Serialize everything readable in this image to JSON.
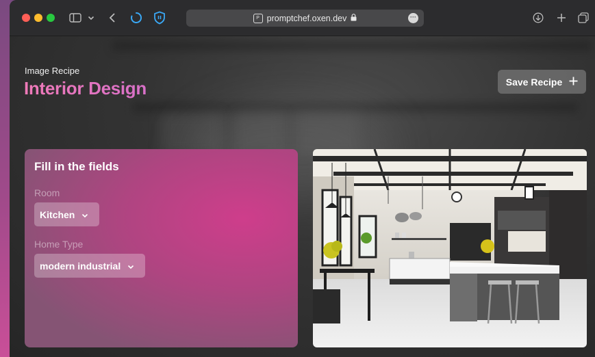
{
  "browser": {
    "url": "promptchef.oxen.dev",
    "icons": [
      "sidebar-icon",
      "chevron-down-icon",
      "back-icon",
      "loading-icon",
      "shield-icon",
      "lock-icon",
      "more-icon",
      "download-icon",
      "new-tab-icon",
      "tabs-icon"
    ]
  },
  "page": {
    "subtitle": "Image Recipe",
    "title": "Interior Design",
    "save_button": "Save Recipe",
    "accent_color": "#e276b9"
  },
  "form": {
    "heading": "Fill in the fields",
    "fields": [
      {
        "label": "Room",
        "value": "Kitchen"
      },
      {
        "label": "Home Type",
        "value": "modern industrial"
      }
    ]
  },
  "image": {
    "subject": "modern industrial kitchen"
  }
}
